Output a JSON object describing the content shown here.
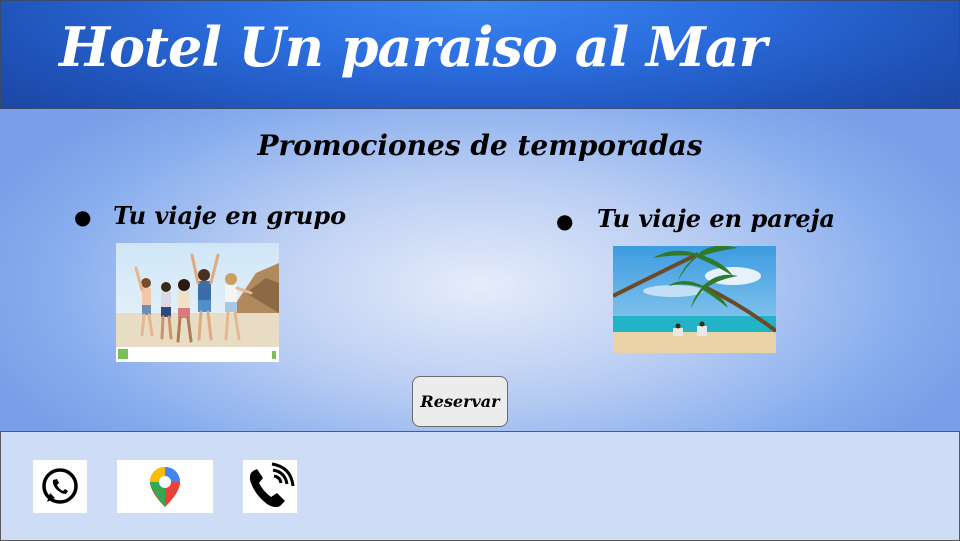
{
  "header": {
    "title": "Hotel Un paraiso al Mar"
  },
  "promotions": {
    "title": "Promociones de temporadas",
    "items": [
      {
        "label": "Tu viaje en grupo",
        "image": "group-beach-photo"
      },
      {
        "label": "Tu viaje en pareja",
        "image": "couple-beach-photo"
      }
    ]
  },
  "reserve_button": {
    "label": "Reservar"
  },
  "footer": {
    "icons": [
      "whatsapp-icon",
      "google-maps-icon",
      "phone-icon"
    ]
  },
  "colors": {
    "header_blue": "#2c6fe0",
    "footer_bg": "#cfdcf6",
    "whatsapp": "#000000",
    "maps_red": "#ea4335"
  }
}
